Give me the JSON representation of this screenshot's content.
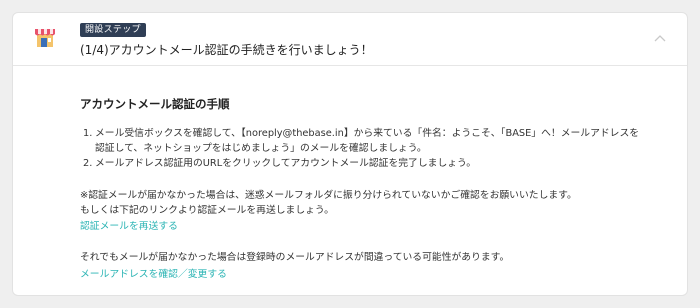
{
  "header": {
    "badge": "開設ステップ",
    "title": "(1/4)アカウントメール認証の手続きを行いましょう！"
  },
  "section": {
    "title": "アカウントメール認証の手順",
    "steps": [
      {
        "num": "1.",
        "line1": "メール受信ボックスを確認して、【noreply@thebase.in】から来ている「件名：ようこそ、「BASE」へ！メールアドレスを",
        "line2": "認証して、ネットショップをはじめましょう」のメールを確認しましょう。"
      },
      {
        "num": "2.",
        "line1": "メールアドレス認証用のURLをクリックしてアカウントメール認証を完了しましょう。"
      }
    ],
    "note_line1": "※認証メールが届かなかった場合は、迷惑メールフォルダに振り分けられていないかご確認をお願いいたします。",
    "note_line2": "もしくは下記のリンクより認証メールを再送しましょう。",
    "resend_link": "認証メールを再送する",
    "note2": "それでもメールが届かなかった場合は登録時のメールアドレスが間違っている可能性があります。",
    "change_email_link": "メールアドレスを確認／変更する"
  },
  "colors": {
    "badge_bg": "#2f3e55",
    "link": "#2bb4b4"
  },
  "icons": {
    "header": "shop-icon",
    "toggle": "chevron-up-icon"
  }
}
